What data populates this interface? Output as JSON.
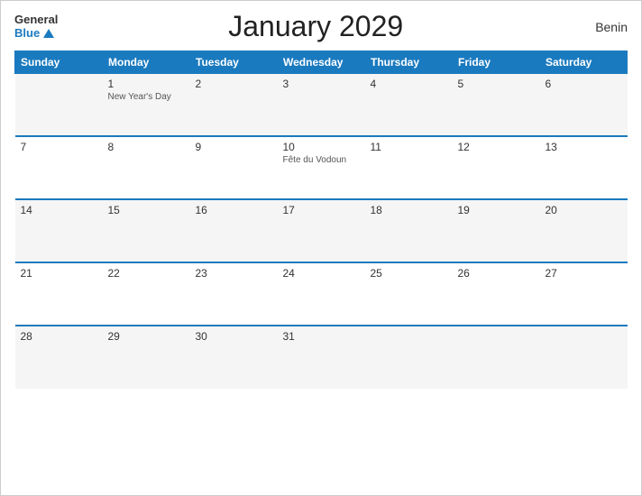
{
  "header": {
    "logo": {
      "general": "General",
      "blue": "Blue"
    },
    "title": "January 2029",
    "country": "Benin"
  },
  "weekdays": [
    "Sunday",
    "Monday",
    "Tuesday",
    "Wednesday",
    "Thursday",
    "Friday",
    "Saturday"
  ],
  "weeks": [
    [
      {
        "day": "",
        "event": ""
      },
      {
        "day": "1",
        "event": "New Year's Day"
      },
      {
        "day": "2",
        "event": ""
      },
      {
        "day": "3",
        "event": ""
      },
      {
        "day": "4",
        "event": ""
      },
      {
        "day": "5",
        "event": ""
      },
      {
        "day": "6",
        "event": ""
      }
    ],
    [
      {
        "day": "7",
        "event": ""
      },
      {
        "day": "8",
        "event": ""
      },
      {
        "day": "9",
        "event": ""
      },
      {
        "day": "10",
        "event": "Fête du Vodoun"
      },
      {
        "day": "11",
        "event": ""
      },
      {
        "day": "12",
        "event": ""
      },
      {
        "day": "13",
        "event": ""
      }
    ],
    [
      {
        "day": "14",
        "event": ""
      },
      {
        "day": "15",
        "event": ""
      },
      {
        "day": "16",
        "event": ""
      },
      {
        "day": "17",
        "event": ""
      },
      {
        "day": "18",
        "event": ""
      },
      {
        "day": "19",
        "event": ""
      },
      {
        "day": "20",
        "event": ""
      }
    ],
    [
      {
        "day": "21",
        "event": ""
      },
      {
        "day": "22",
        "event": ""
      },
      {
        "day": "23",
        "event": ""
      },
      {
        "day": "24",
        "event": ""
      },
      {
        "day": "25",
        "event": ""
      },
      {
        "day": "26",
        "event": ""
      },
      {
        "day": "27",
        "event": ""
      }
    ],
    [
      {
        "day": "28",
        "event": ""
      },
      {
        "day": "29",
        "event": ""
      },
      {
        "day": "30",
        "event": ""
      },
      {
        "day": "31",
        "event": ""
      },
      {
        "day": "",
        "event": ""
      },
      {
        "day": "",
        "event": ""
      },
      {
        "day": "",
        "event": ""
      }
    ]
  ]
}
